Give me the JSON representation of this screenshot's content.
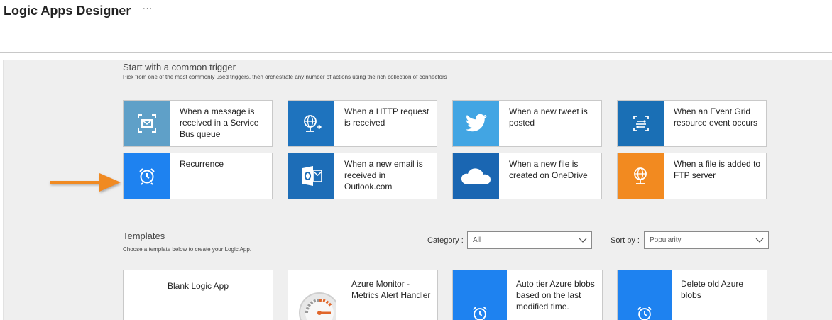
{
  "header": {
    "title": "Logic Apps Designer",
    "more_label": "···"
  },
  "triggers_section": {
    "title": "Start with a common trigger",
    "subtitle": "Pick from one of the most commonly used triggers, then orchestrate any number of actions using the rich collection of connectors"
  },
  "triggers": [
    {
      "label": "When a message is received in a Service Bus queue",
      "icon": "service-bus-icon",
      "color": "#5fa0c8"
    },
    {
      "label": "When a HTTP request is received",
      "icon": "http-request-icon",
      "color": "#1e73be"
    },
    {
      "label": "When a new tweet is posted",
      "icon": "twitter-icon",
      "color": "#42a5e3"
    },
    {
      "label": "When an Event Grid resource event occurs",
      "icon": "event-grid-icon",
      "color": "#1a6fb5"
    },
    {
      "label": "Recurrence",
      "icon": "alarm-clock-icon",
      "color": "#1e82f0"
    },
    {
      "label": "When a new email is received in Outlook.com",
      "icon": "outlook-icon",
      "color": "#1d6db7"
    },
    {
      "label": "When a new file is created on OneDrive",
      "icon": "onedrive-icon",
      "color": "#1a66b2"
    },
    {
      "label": "When a file is added to FTP server",
      "icon": "ftp-icon",
      "color": "#f28a20"
    }
  ],
  "templates_section": {
    "title": "Templates",
    "subtitle": "Choose a template below to create your Logic App.",
    "category_label": "Category :",
    "category_value": "All",
    "sort_label": "Sort by :",
    "sort_value": "Popularity"
  },
  "templates": [
    {
      "label": "Blank Logic App",
      "icon": "",
      "color": "#ffffff"
    },
    {
      "label": "Azure Monitor - Metrics Alert Handler",
      "icon": "gauge-icon",
      "color": "#ffffff"
    },
    {
      "label": "Auto tier Azure blobs based on the last modified time.",
      "icon": "alarm-clock-icon",
      "color": "#1e82f0"
    },
    {
      "label": "Delete old Azure blobs",
      "icon": "alarm-clock-icon",
      "color": "#1e82f0"
    }
  ],
  "annotation": {
    "arrow_color": "#f08a24"
  }
}
